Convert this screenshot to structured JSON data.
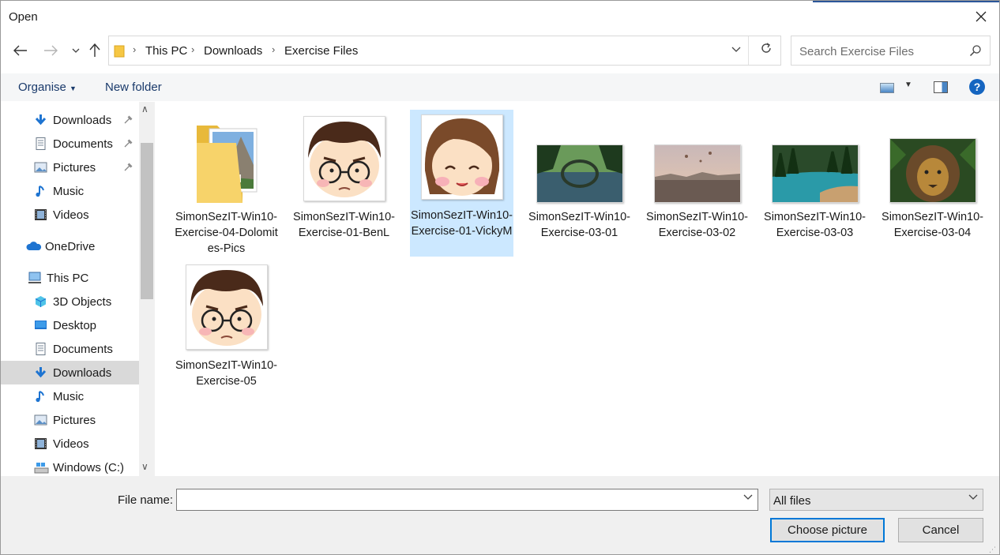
{
  "window": {
    "title": "Open"
  },
  "address": {
    "segments": [
      "This PC",
      "Downloads",
      "Exercise Files"
    ]
  },
  "search": {
    "placeholder": "Search Exercise Files"
  },
  "toolbar": {
    "organise": "Organise",
    "new_folder": "New folder"
  },
  "sidebar": {
    "items": [
      {
        "label": "Downloads",
        "icon": "download-arrow-icon",
        "pinned": true
      },
      {
        "label": "Documents",
        "icon": "document-icon",
        "pinned": true
      },
      {
        "label": "Pictures",
        "icon": "pictures-icon",
        "pinned": true
      },
      {
        "label": "Music",
        "icon": "music-note-icon",
        "pinned": false
      },
      {
        "label": "Videos",
        "icon": "film-icon",
        "pinned": false
      },
      {
        "label": "OneDrive",
        "icon": "cloud-icon",
        "pinned": false
      },
      {
        "label": "This PC",
        "icon": "computer-icon",
        "pinned": false
      },
      {
        "label": "3D Objects",
        "icon": "cube-icon",
        "pinned": false
      },
      {
        "label": "Desktop",
        "icon": "desktop-icon",
        "pinned": false
      },
      {
        "label": "Documents",
        "icon": "document-icon",
        "pinned": false
      },
      {
        "label": "Downloads",
        "icon": "download-arrow-icon",
        "pinned": false,
        "selected": true
      },
      {
        "label": "Music",
        "icon": "music-note-icon",
        "pinned": false
      },
      {
        "label": "Pictures",
        "icon": "pictures-icon",
        "pinned": false
      },
      {
        "label": "Videos",
        "icon": "film-icon",
        "pinned": false
      },
      {
        "label": "Windows (C:)",
        "icon": "drive-icon",
        "pinned": false
      }
    ]
  },
  "files": [
    {
      "name": "SimonSezIT-Win10-Exercise-04-Dolomites-Pics",
      "kind": "folder"
    },
    {
      "name": "SimonSezIT-Win10-Exercise-01-BenL",
      "kind": "avatar-boy"
    },
    {
      "name": "SimonSezIT-Win10-Exercise-01-VickyM",
      "kind": "avatar-girl",
      "selected": true
    },
    {
      "name": "SimonSezIT-Win10-Exercise-03-01",
      "kind": "photo-bridge"
    },
    {
      "name": "SimonSezIT-Win10-Exercise-03-02",
      "kind": "photo-city"
    },
    {
      "name": "SimonSezIT-Win10-Exercise-03-03",
      "kind": "photo-lake"
    },
    {
      "name": "SimonSezIT-Win10-Exercise-03-04",
      "kind": "photo-lion"
    },
    {
      "name": "SimonSezIT-Win10-Exercise-05",
      "kind": "avatar-boy"
    }
  ],
  "footer": {
    "file_name_label": "File name:",
    "file_name_value": "",
    "filter": "All files",
    "open_button": "Choose picture",
    "cancel_button": "Cancel"
  },
  "colors": {
    "accent": "#0078d7",
    "selection": "#cce8ff",
    "nav_selected": "#d9d9d9"
  }
}
